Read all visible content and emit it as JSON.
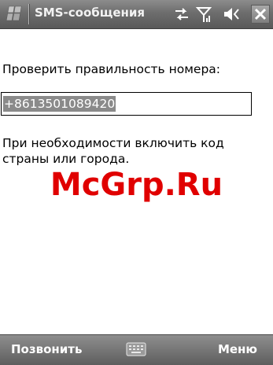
{
  "titlebar": {
    "title": "SMS-сообщения",
    "icons": [
      "windows-start-icon",
      "sync-arrows-icon",
      "signal-antenna-icon",
      "speaker-icon",
      "close-icon"
    ]
  },
  "content": {
    "prompt": "Проверить правильность номера:",
    "phone_number": "+8613501089420",
    "hint": "При необходимости включить код страны или города.",
    "watermark": "McGrp.Ru"
  },
  "softkeys": {
    "left": "Позвонить",
    "right": "Меню",
    "center_icon": "keyboard-icon"
  },
  "colors": {
    "bar_gray": "#6d6d6d",
    "selection_gray": "#8a8a8a",
    "watermark_red": "#e00000"
  }
}
